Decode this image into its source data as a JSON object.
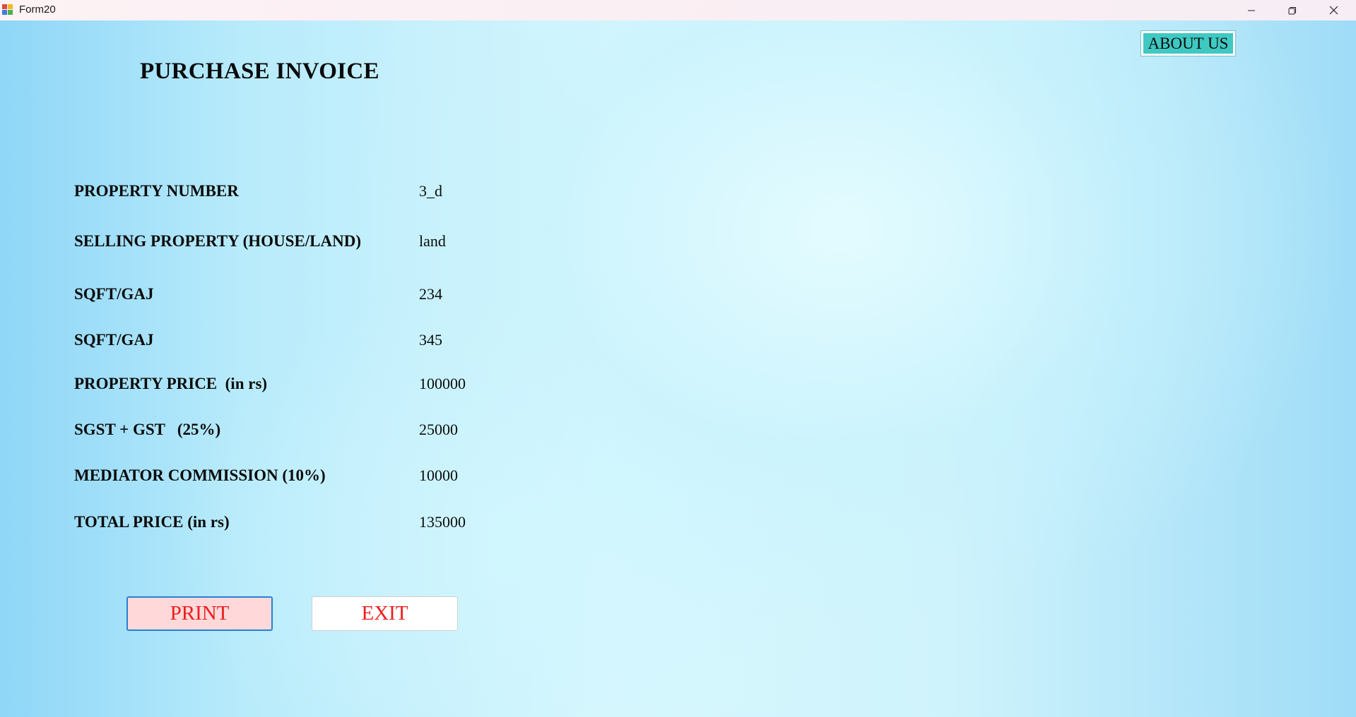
{
  "window": {
    "title": "Form20",
    "controls": {
      "minimize_icon": "minimize-icon",
      "restore_icon": "restore-icon",
      "close_icon": "close-icon"
    }
  },
  "header": {
    "title": "PURCHASE INVOICE",
    "about_label": "ABOUT US"
  },
  "fields": [
    {
      "label": "PROPERTY NUMBER",
      "value": "3_d"
    },
    {
      "label": "SELLING PROPERTY (HOUSE/LAND)",
      "value": "land"
    },
    {
      "label": "SQFT/GAJ",
      "value": "234"
    },
    {
      "label": "SQFT/GAJ",
      "value": "345"
    },
    {
      "label": "PROPERTY PRICE  (in rs)",
      "value": "100000"
    },
    {
      "label": "SGST + GST   (25%)",
      "value": "25000"
    },
    {
      "label": "MEDIATOR COMMISSION (10%)",
      "value": "10000"
    },
    {
      "label": "TOTAL PRICE (in rs)",
      "value": "135000"
    }
  ],
  "actions": {
    "print_label": "PRINT",
    "exit_label": "EXIT"
  },
  "colors": {
    "about_bg": "#3fc9c2",
    "button_text": "#ee1c1c",
    "print_bg": "#ffd9da",
    "print_border": "#2a7fd4"
  }
}
